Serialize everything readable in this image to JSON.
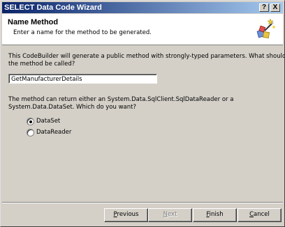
{
  "window": {
    "title": "SELECT Data Code Wizard",
    "help_button": "?",
    "close_button": "X"
  },
  "header": {
    "title": "Name Method",
    "subtitle": "Enter a name for the method to be generated."
  },
  "body": {
    "intro_line1": "This CodeBuilder will generate a public method with strongly-typed parameters.  What should",
    "intro_line2": "the method be called?",
    "method_name_value": "GetManufacturerDetails",
    "return_line1": "The method can return either an System.Data.SqlClient.SqlDataReader or a",
    "return_line2": "System.Data.DataSet.  Which do you want?",
    "options": [
      {
        "label": "DataSet",
        "selected": true
      },
      {
        "label": "DataReader",
        "selected": false
      }
    ]
  },
  "buttons": {
    "previous": {
      "mnemonic": "P",
      "rest": "revious"
    },
    "next": {
      "mnemonic": "N",
      "rest": "ext",
      "enabled": false
    },
    "finish": {
      "mnemonic": "F",
      "rest": "inish"
    },
    "cancel": {
      "mnemonic": "C",
      "rest": "ancel"
    }
  }
}
